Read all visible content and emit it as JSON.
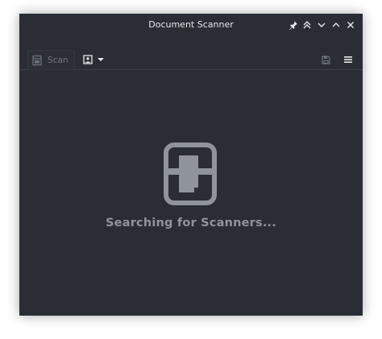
{
  "window": {
    "title": "Document Scanner"
  },
  "titlebar_buttons": [
    {
      "icon": "pin-icon"
    },
    {
      "icon": "keep-above-icon"
    },
    {
      "icon": "minimize-icon"
    },
    {
      "icon": "maximize-icon"
    },
    {
      "icon": "close-icon"
    }
  ],
  "toolbar": {
    "scan_label": "Scan",
    "scan_icon": "scanner-icon",
    "mode_icon": "image-mode-icon",
    "save_icon": "save-icon",
    "menu_icon": "hamburger-menu-icon"
  },
  "main": {
    "status": "Searching for Scanners..."
  },
  "colors": {
    "background": "#2a2e34",
    "text": "#e6e8ea",
    "muted": "#8f949a",
    "disabled": "#6e737a"
  }
}
